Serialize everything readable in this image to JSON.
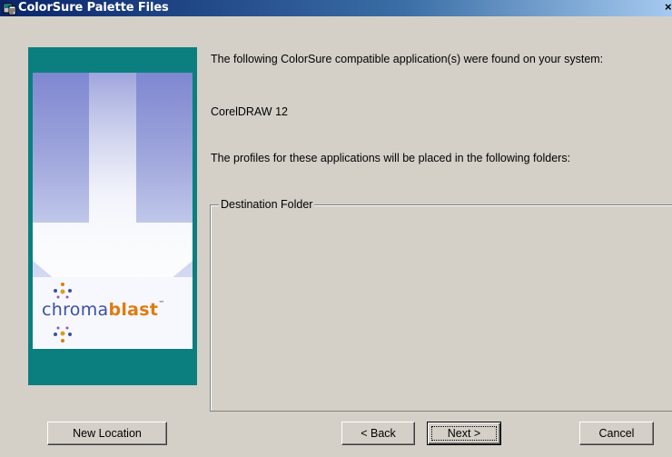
{
  "window": {
    "title": "ColorSure Palette Files",
    "close_glyph": "×"
  },
  "banner": {
    "logo_part1": "chroma",
    "logo_part2": "blast",
    "logo_tm": "™",
    "colors": {
      "frame": "#0b7f7f",
      "logo_blue": "#3a4fa8",
      "logo_orange": "#e07b10"
    }
  },
  "content": {
    "intro": "The following ColorSure compatible application(s) were found on your system:",
    "application": "CorelDRAW 12",
    "profiles_note": "The profiles for these applications will be placed in the following folders:",
    "destination_label": "Destination Folder"
  },
  "buttons": {
    "new_location": "New Location",
    "back": "< Back",
    "next": "Next >",
    "cancel": "Cancel"
  }
}
